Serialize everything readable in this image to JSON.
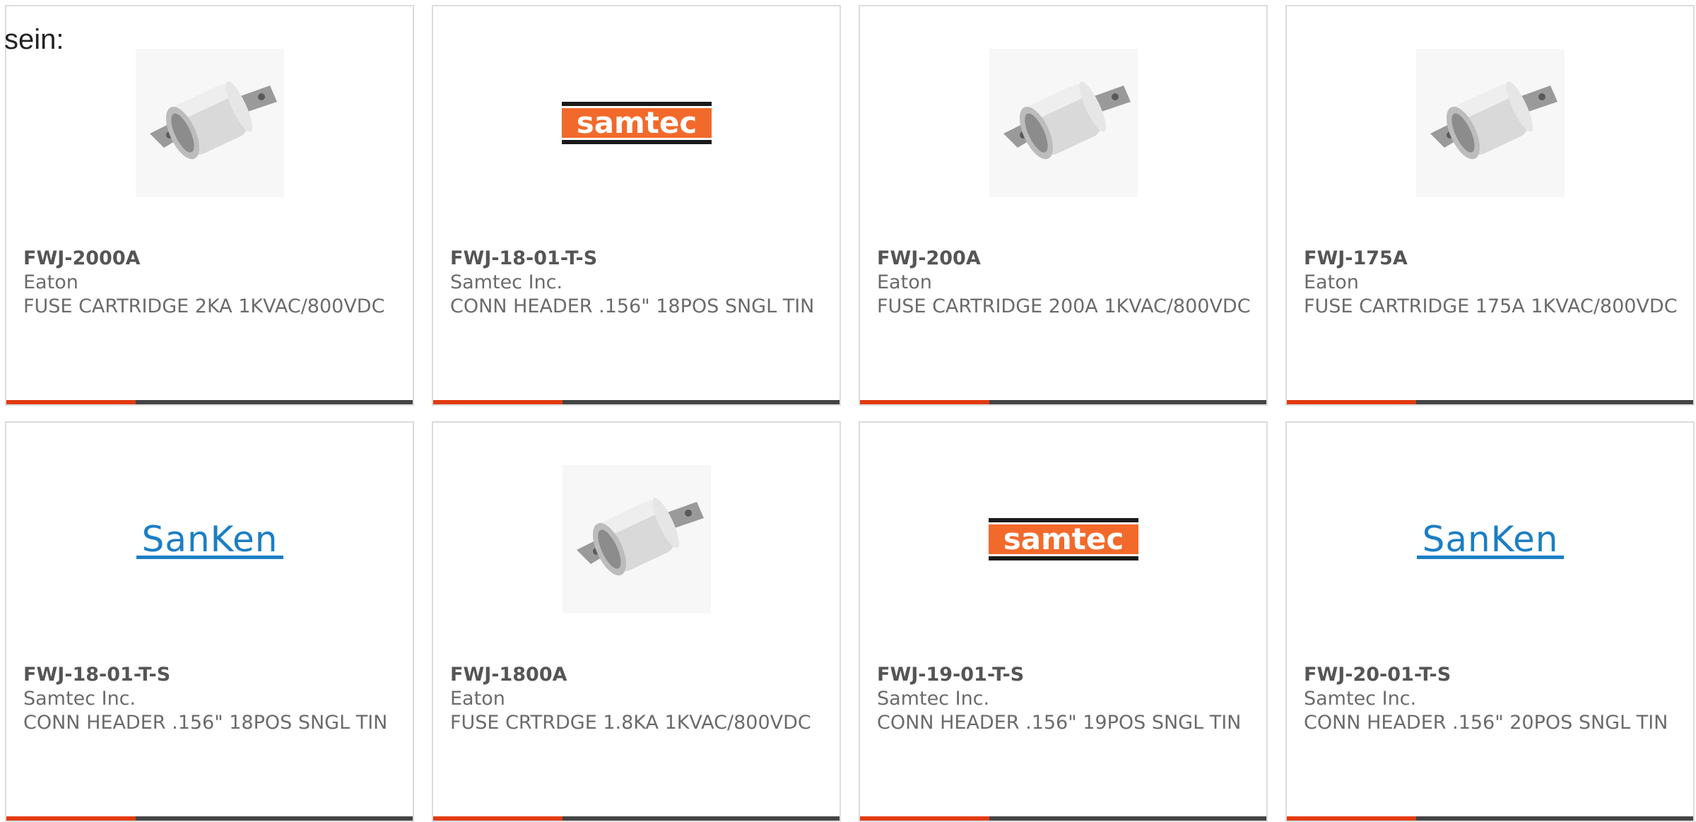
{
  "intro_text": "sein:",
  "colors": {
    "accent": "#e23b12",
    "bar": "#444444",
    "samtec_orange": "#f26a2b",
    "sanken_blue": "#1c7ec4"
  },
  "products": [
    {
      "part_number": "FWJ-2000A",
      "manufacturer": "Eaton",
      "description": "FUSE CARTRIDGE 2KA 1KVAC/800VDC",
      "image": "fuse-cartridge-image"
    },
    {
      "part_number": "FWJ-18-01-T-S",
      "manufacturer": "Samtec Inc.",
      "description": "CONN HEADER .156\" 18POS SNGL TIN",
      "image": "samtec-logo",
      "logo_text": "samtec"
    },
    {
      "part_number": "FWJ-200A",
      "manufacturer": "Eaton",
      "description": "FUSE CARTRIDGE 200A 1KVAC/800VDC",
      "image": "fuse-cartridge-image"
    },
    {
      "part_number": "FWJ-175A",
      "manufacturer": "Eaton",
      "description": "FUSE CARTRIDGE 175A 1KVAC/800VDC",
      "image": "fuse-cartridge-image"
    },
    {
      "part_number": "FWJ-18-01-T-S",
      "manufacturer": "Samtec Inc.",
      "description": "CONN HEADER .156\" 18POS SNGL TIN",
      "image": "sanken-logo",
      "logo_text": "SanKen"
    },
    {
      "part_number": "FWJ-1800A",
      "manufacturer": "Eaton",
      "description": "FUSE CRTRDGE 1.8KA 1KVAC/800VDC",
      "image": "fuse-cartridge-image"
    },
    {
      "part_number": "FWJ-19-01-T-S",
      "manufacturer": "Samtec Inc.",
      "description": "CONN HEADER .156\" 19POS SNGL TIN",
      "image": "samtec-logo",
      "logo_text": "samtec"
    },
    {
      "part_number": "FWJ-20-01-T-S",
      "manufacturer": "Samtec Inc.",
      "description": "CONN HEADER .156\" 20POS SNGL TIN",
      "image": "sanken-logo",
      "logo_text": "SanKen"
    }
  ]
}
